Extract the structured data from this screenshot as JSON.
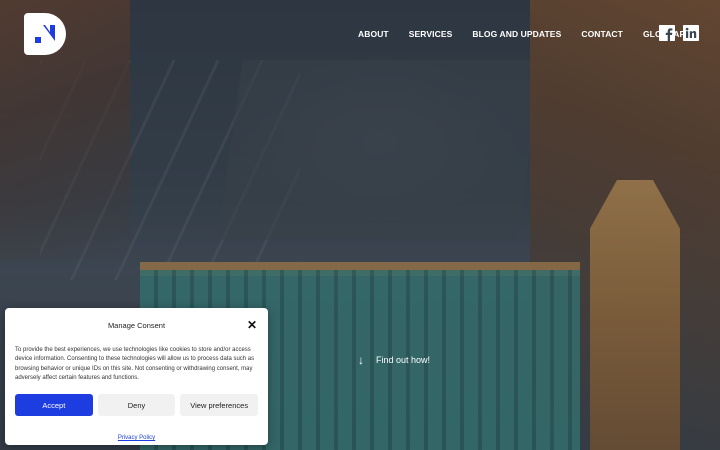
{
  "nav": {
    "items": [
      {
        "label": "ABOUT"
      },
      {
        "label": "SERVICES"
      },
      {
        "label": "BLOG AND UPDATES"
      },
      {
        "label": "CONTACT"
      },
      {
        "label": "GLOSSARY"
      }
    ]
  },
  "social": {
    "facebook_icon": "facebook-icon",
    "linkedin_icon": "linkedin-icon"
  },
  "hero": {
    "cta_label": "Find out how!",
    "cta_icon": "arrow-down-icon"
  },
  "consent": {
    "title": "Manage Consent",
    "close_icon": "close-icon",
    "body": "To provide the best experiences, we use technologies like cookies to store and/or access device information. Consenting to these technologies will allow us to process data such as browsing behavior or unique IDs on this site. Not consenting or withdrawing consent, may adversely affect certain features and functions.",
    "accept_label": "Accept",
    "deny_label": "Deny",
    "preferences_label": "View preferences",
    "privacy_label": "Privacy Policy"
  },
  "colors": {
    "accent": "#1e3de0",
    "nav_text": "#ffffff",
    "dialog_bg": "#ffffff"
  }
}
